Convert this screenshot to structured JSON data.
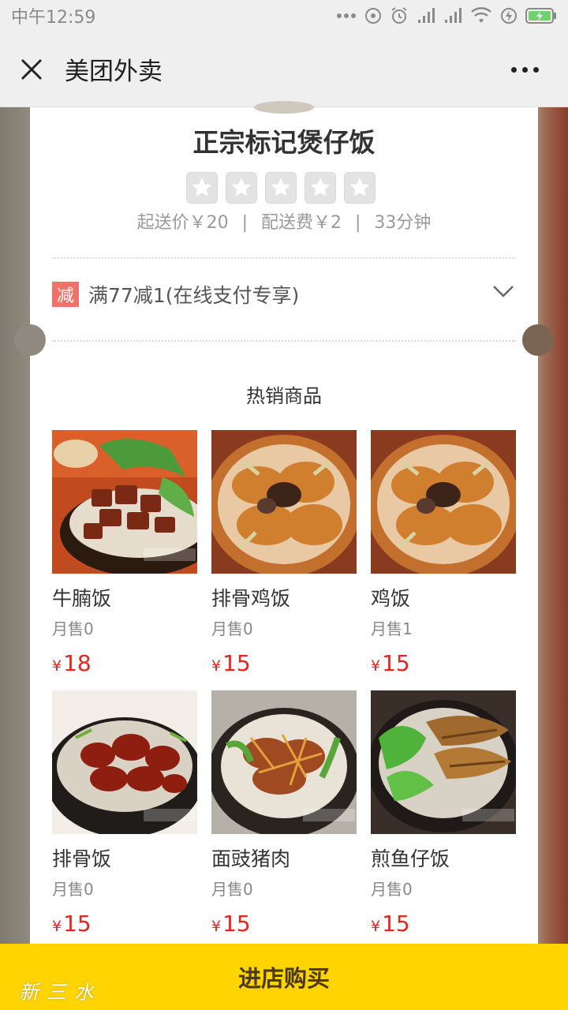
{
  "status_bar": {
    "time": "中午12:59"
  },
  "nav": {
    "title": "美团外卖"
  },
  "shop": {
    "name": "正宗标记煲仔饭",
    "rating_stars": 5,
    "min_order": "起送价￥20",
    "delivery_fee": "配送费￥2",
    "delivery_time": "33分钟",
    "separator": "|"
  },
  "promo": {
    "badge": "减",
    "text": "满77减1(在线支付专享)"
  },
  "hot": {
    "title": "热销商品",
    "items": [
      {
        "name": "牛腩饭",
        "sales": "月售0",
        "currency": "¥",
        "price": "18"
      },
      {
        "name": "排骨鸡饭",
        "sales": "月售0",
        "currency": "¥",
        "price": "15"
      },
      {
        "name": "鸡饭",
        "sales": "月售1",
        "currency": "¥",
        "price": "15"
      },
      {
        "name": "排骨饭",
        "sales": "月售0",
        "currency": "¥",
        "price": "15"
      },
      {
        "name": "面豉猪肉",
        "sales": "月售0",
        "currency": "¥",
        "price": "15"
      },
      {
        "name": "煎鱼仔饭",
        "sales": "月售0",
        "currency": "¥",
        "price": "15"
      }
    ]
  },
  "buy_button": {
    "label": "进店购买"
  },
  "watermark": {
    "text": "新三水"
  },
  "colors": {
    "price": "#e4241f",
    "buy_bar": "#ffd400",
    "promo_badge": "#f0706a"
  }
}
